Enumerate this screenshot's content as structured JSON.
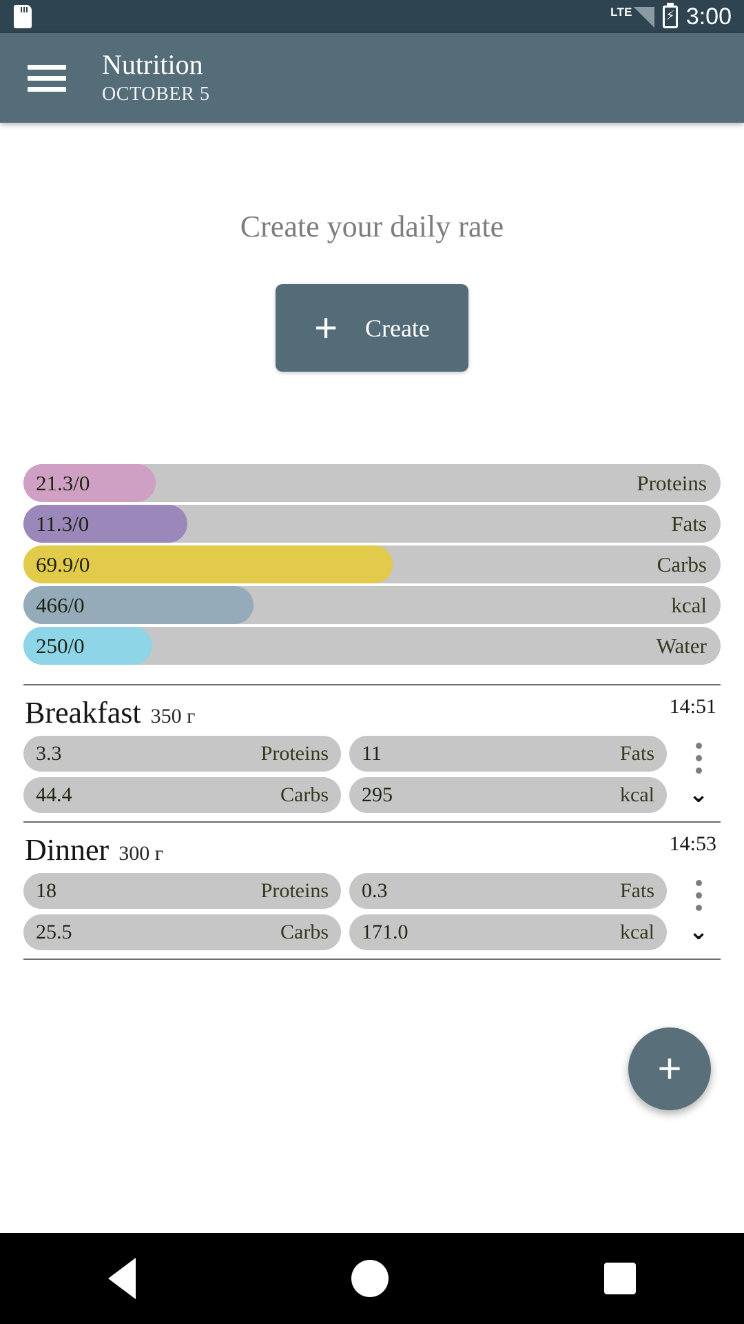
{
  "status_bar": {
    "sd_card_icon": "sd-card-icon",
    "network_label": "LTE",
    "signal_icon": "signal-bars-icon",
    "battery_icon": "battery-charging-icon",
    "time": "3:00"
  },
  "app_bar": {
    "menu_icon": "hamburger-menu-icon",
    "title": "Nutrition",
    "subtitle": "OCTOBER 5"
  },
  "daily_rate": {
    "heading": "Create your daily rate",
    "create_button": {
      "icon": "plus-icon",
      "label": "Create"
    }
  },
  "macros": [
    {
      "name": "Proteins",
      "value": "21.3/0",
      "color": "#cfa0c4",
      "percent": 19
    },
    {
      "name": "Fats",
      "value": "11.3/0",
      "color": "#9b87b9",
      "percent": 23.5
    },
    {
      "name": "Carbs",
      "value": "69.9/0",
      "color": "#e2ca4b",
      "percent": 53
    },
    {
      "name": "kcal",
      "value": "466/0",
      "color": "#96abb9",
      "percent": 33
    },
    {
      "name": "Water",
      "value": "250/0",
      "color": "#8ed5e8",
      "percent": 18.5
    }
  ],
  "meals": [
    {
      "name": "Breakfast",
      "weight": "350 г",
      "time": "14:51",
      "nutrients": [
        {
          "value": "3.3",
          "label": "Proteins"
        },
        {
          "value": "11",
          "label": "Fats"
        },
        {
          "value": "44.4",
          "label": "Carbs"
        },
        {
          "value": "295",
          "label": "kcal"
        }
      ],
      "more_icon": "kebab-menu-icon",
      "expand_icon": "chevron-down-icon"
    },
    {
      "name": "Dinner",
      "weight": "300 г",
      "time": "14:53",
      "nutrients": [
        {
          "value": "18",
          "label": "Proteins"
        },
        {
          "value": "0.3",
          "label": "Fats"
        },
        {
          "value": "25.5",
          "label": "Carbs"
        },
        {
          "value": "171.0",
          "label": "kcal"
        }
      ],
      "more_icon": "kebab-menu-icon",
      "expand_icon": "chevron-down-icon"
    }
  ],
  "fab": {
    "icon": "plus-icon",
    "label": "+"
  },
  "nav_bar": {
    "back": "back-triangle-icon",
    "home": "home-circle-icon",
    "recents": "recents-square-icon"
  },
  "theme": {
    "status_bar_bg": "#2e4450",
    "app_bar_bg": "#546d79",
    "accent": "#536c78",
    "track": "#c6c6c6"
  }
}
